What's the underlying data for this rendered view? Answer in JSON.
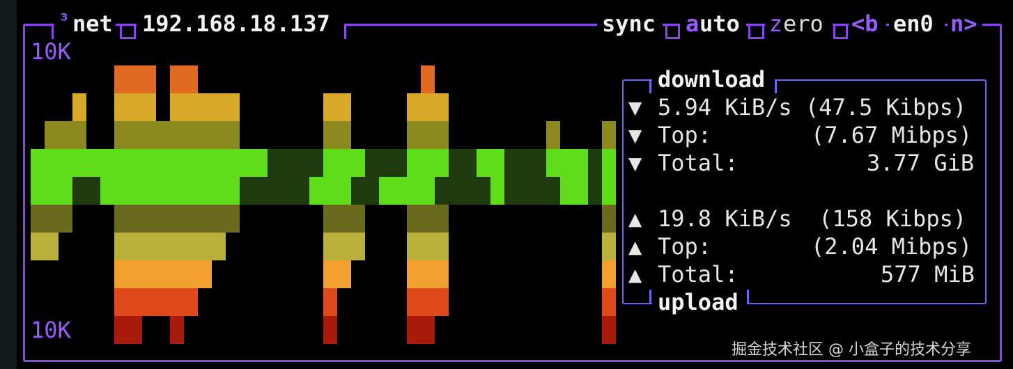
{
  "panel": {
    "superscript": "³",
    "title": "net",
    "ip": "192.168.18.137",
    "opt_sync": "sync",
    "opt_auto_a": "a",
    "opt_auto_rest": "uto",
    "opt_zero_z": "z",
    "opt_zero_rest": "ero",
    "prev_if": "<b",
    "iface": "en0",
    "next_if": "n>",
    "scale_top": "10K",
    "scale_bottom": "10K"
  },
  "stats": {
    "download_title": "download",
    "upload_title": "upload",
    "down_arrow": "▼",
    "up_arrow": "▲",
    "down_rate": "5.94 KiB/s (47.5 Kibps)",
    "down_top_label": "Top:",
    "down_top_value": "(7.67 Mibps)",
    "down_total_label": "Total:",
    "down_total_value": "3.77 GiB",
    "up_rate": "19.8 KiB/s  (158 Kibps)",
    "up_top_label": "Top:",
    "up_top_value": "(2.04 Mibps)",
    "up_total_label": "Total:",
    "up_total_value": "577 MiB"
  },
  "watermark": "掘金技术社区 @ 小盒子的技术分享",
  "colors": {
    "border": "#8a45f0",
    "box_border": "#6868f0",
    "accent": "#9a5cff",
    "graph_bright_green": "#5edc1a",
    "graph_dark_green": "#1f3a0c"
  },
  "chart_data": {
    "type": "heatmap",
    "description_note": "",
    "columns": 42,
    "rows_half": 5,
    "download_levels": [
      0,
      1,
      1,
      2,
      0,
      0,
      3,
      3,
      3,
      1,
      3,
      3,
      2,
      2,
      2,
      0,
      0,
      0,
      0,
      0,
      0,
      2,
      2,
      0,
      0,
      0,
      0,
      2,
      3,
      2,
      0,
      0,
      0,
      0,
      0,
      0,
      0,
      1,
      0,
      0,
      0,
      1
    ],
    "upload_levels": [
      2,
      2,
      1,
      0,
      0,
      0,
      5,
      5,
      4,
      4,
      5,
      4,
      3,
      2,
      1,
      0,
      0,
      0,
      0,
      0,
      0,
      5,
      3,
      2,
      0,
      0,
      0,
      5,
      5,
      4,
      0,
      0,
      0,
      0,
      0,
      0,
      0,
      0,
      0,
      0,
      0,
      5
    ],
    "download_mid": [
      1,
      1,
      1,
      1,
      1,
      1,
      1,
      1,
      1,
      1,
      1,
      1,
      1,
      1,
      1,
      1,
      1,
      0,
      0,
      0,
      0,
      1,
      1,
      1,
      0,
      0,
      0,
      1,
      1,
      1,
      0,
      0,
      1,
      1,
      0,
      0,
      0,
      1,
      1,
      1,
      0,
      1
    ],
    "upload_mid": [
      1,
      1,
      1,
      0,
      0,
      1,
      1,
      1,
      1,
      1,
      1,
      1,
      1,
      1,
      1,
      0,
      0,
      0,
      0,
      0,
      1,
      1,
      1,
      0,
      0,
      1,
      1,
      1,
      1,
      0,
      0,
      0,
      0,
      1,
      0,
      0,
      0,
      0,
      1,
      1,
      0,
      1
    ]
  }
}
